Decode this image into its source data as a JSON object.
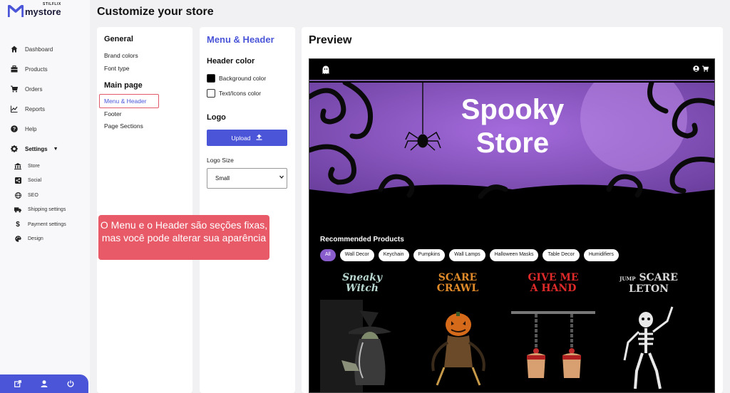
{
  "brand": {
    "small": "STILFLIX",
    "name": "mystore",
    "accent": "#4a55d8"
  },
  "page_title": "Customize your store",
  "sidebar": {
    "items": [
      {
        "label": "Dashboard",
        "icon": "home-icon"
      },
      {
        "label": "Products",
        "icon": "box-icon"
      },
      {
        "label": "Orders",
        "icon": "cart-icon"
      },
      {
        "label": "Reports",
        "icon": "chart-icon"
      },
      {
        "label": "Help",
        "icon": "help-icon"
      },
      {
        "label": "Settings",
        "icon": "gear-icon"
      }
    ],
    "settings_items": [
      {
        "label": "Store",
        "icon": "store-icon"
      },
      {
        "label": "Social",
        "icon": "share-icon"
      },
      {
        "label": "SEO",
        "icon": "globe-icon"
      },
      {
        "label": "Shipping settings",
        "icon": "truck-icon"
      },
      {
        "label": "Payment settings",
        "icon": "dollar-icon"
      },
      {
        "label": "Design",
        "icon": "palette-icon"
      }
    ],
    "bottom_icons": [
      "external-link-icon",
      "user-icon",
      "power-icon"
    ]
  },
  "sections": {
    "general": {
      "title": "General",
      "items": [
        "Brand colors",
        "Font type"
      ]
    },
    "main_page": {
      "title": "Main page",
      "active": "Menu & Header",
      "items": [
        "Footer",
        "Page Sections"
      ]
    }
  },
  "menu_header": {
    "title": "Menu & Header",
    "header_color": {
      "title": "Header color",
      "background_label": "Background color",
      "text_label": "Text/Icons color"
    },
    "logo": {
      "title": "Logo",
      "upload_label": "Upload"
    },
    "logo_size": {
      "label": "Logo Size",
      "value": "Small"
    }
  },
  "tooltip": "O Menu e o Header são seções fixas, mas você pode alterar sua aparência",
  "preview": {
    "title": "Preview",
    "banner_title_line1": "Spooky",
    "banner_title_line2": "Store",
    "recommended_title": "Recommended Products",
    "chips": [
      "All",
      "Wall Decor",
      "Keychain",
      "Pumpkins",
      "Wall Lamps",
      "Halloween Masks",
      "Table Decor",
      "Humidifiers"
    ],
    "products": [
      {
        "title_line1": "Sneaky",
        "title_line2": "Witch"
      },
      {
        "title_line1": "SCARE",
        "title_line2": "CRAWL"
      },
      {
        "title_line1": "GIVE ME",
        "title_line2": "A HAND"
      },
      {
        "title_line1": "SCARE",
        "title_line2": "LETON",
        "prefix": "JUMP"
      }
    ]
  },
  "colors": {
    "tooltip": "#e85a68",
    "purple": "#8a5dcc",
    "active_border": "#e05a6a"
  }
}
